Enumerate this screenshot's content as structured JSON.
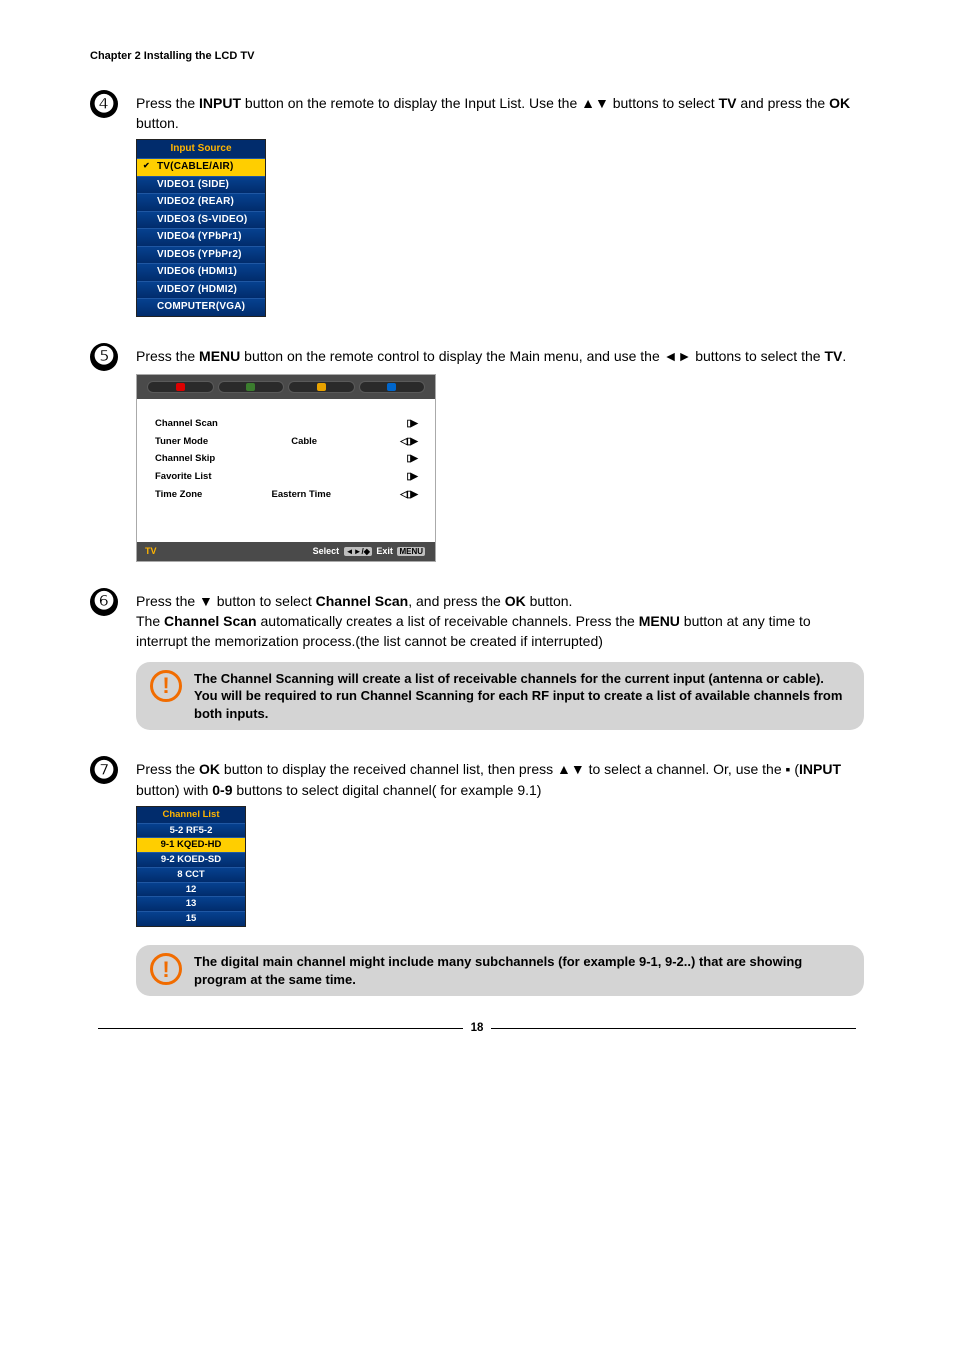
{
  "header": "Chapter 2 Installing the LCD TV",
  "step4": {
    "text_a": "Press the ",
    "input_b": "INPUT",
    "text_c": " button on the remote to display the Input List. Use the ▲▼ buttons to select ",
    "tv_b": "TV",
    "text_d": " and press the ",
    "ok_b": "OK",
    "text_e": " button.",
    "input_source_title": "Input Source",
    "rows": [
      "TV(CABLE/AIR)",
      "VIDEO1 (SIDE)",
      "VIDEO2 (REAR)",
      "VIDEO3 (S-VIDEO)",
      "VIDEO4 (YPbPr1)",
      "VIDEO5 (YPbPr2)",
      "VIDEO6 (HDMI1)",
      "VIDEO7 (HDMI2)",
      "COMPUTER(VGA)"
    ]
  },
  "step5": {
    "text_a": "Press the ",
    "menu_b": "MENU",
    "text_c": " button on the remote control to display the Main menu, and use the ◄► buttons to select the ",
    "tv_b": "TV",
    "text_d": ".",
    "lines": [
      {
        "l": "Channel Scan",
        "m": "",
        "r": "▯▶"
      },
      {
        "l": "Tuner Mode",
        "m": "Cable",
        "r": "◁▯▶"
      },
      {
        "l": "Channel Skip",
        "m": "",
        "r": "▯▶"
      },
      {
        "l": "Favorite List",
        "m": "",
        "r": "▯▶"
      },
      {
        "l": "Time Zone",
        "m": "Eastern Time",
        "r": "◁▯▶"
      }
    ],
    "footer_tv": "TV",
    "footer_select": "Select",
    "footer_keys": "◄►/◆",
    "footer_exit": "Exit",
    "footer_menu": "MENU"
  },
  "step6": {
    "text_a": "Press the ▼ button to select ",
    "cs_b": "Channel Scan",
    "text_c": ", and press the ",
    "ok_b": "OK",
    "text_d": " button.",
    "text_e": "The ",
    "cs_b2": "Channel Scan",
    "text_f": " automatically creates a list of receivable channels. Press the ",
    "menu_b": "MENU",
    "text_g": " button at any time to interrupt the memorization process.(the list cannot be created if interrupted)",
    "alert": "The Channel Scanning will create a list of  receivable channels for the current input (antenna or cable). You will be required to run Channel Scanning for each RF input to create a list of  available channels from both inputs."
  },
  "step7": {
    "text_a": "Press the ",
    "ok_b": "OK",
    "text_b": " button to display the received channel list, then press ▲▼ to select a channel. Or, use the ▪ (",
    "input_b": "INPUT",
    "text_c": " button) with ",
    "num_b": "0-9",
    "text_d": " buttons to select digital channel( for example 9.1)",
    "cl_title": "Channel List",
    "cl_rows": [
      "5-2 RF5-2",
      "9-1 KQED-HD",
      "9-2 KOED-SD",
      "8    CCT",
      "12",
      "13",
      "15"
    ],
    "alert": "The digital main channel might include many subchannels (for example 9-1, 9-2..) that are showing program at the same time."
  },
  "page_number": "18"
}
